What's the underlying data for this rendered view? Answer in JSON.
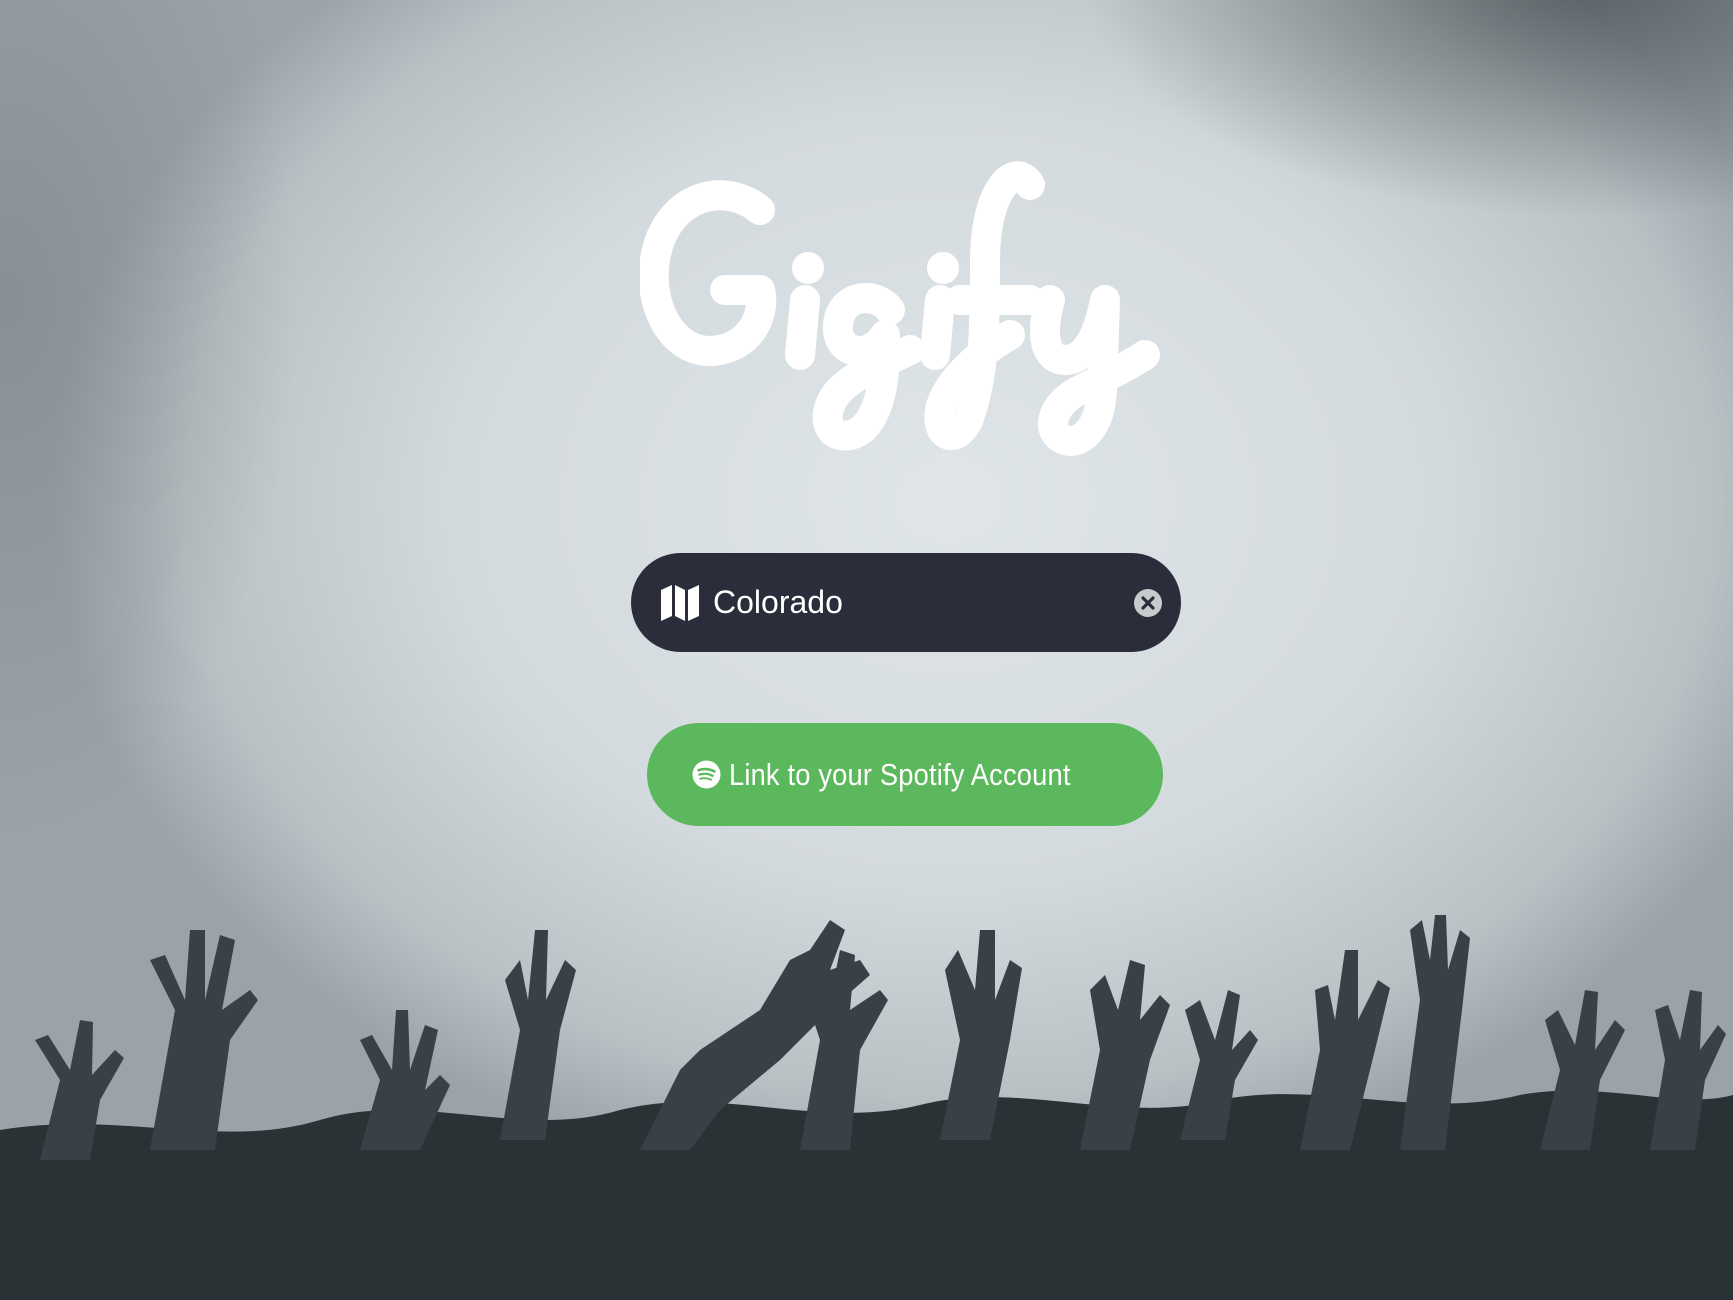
{
  "brand": {
    "logo_text": "Gigify",
    "colors": {
      "field_background": "#2b2e3a",
      "button_background": "#5cb85c",
      "text": "#ffffff"
    }
  },
  "background": {
    "description_icon": "concert-crowd-photo"
  },
  "location": {
    "value": "Colorado",
    "icon": "map-icon",
    "clear_icon": "clear-icon"
  },
  "spotify": {
    "label": "Link to your Spotify Account",
    "icon": "spotify-icon"
  }
}
